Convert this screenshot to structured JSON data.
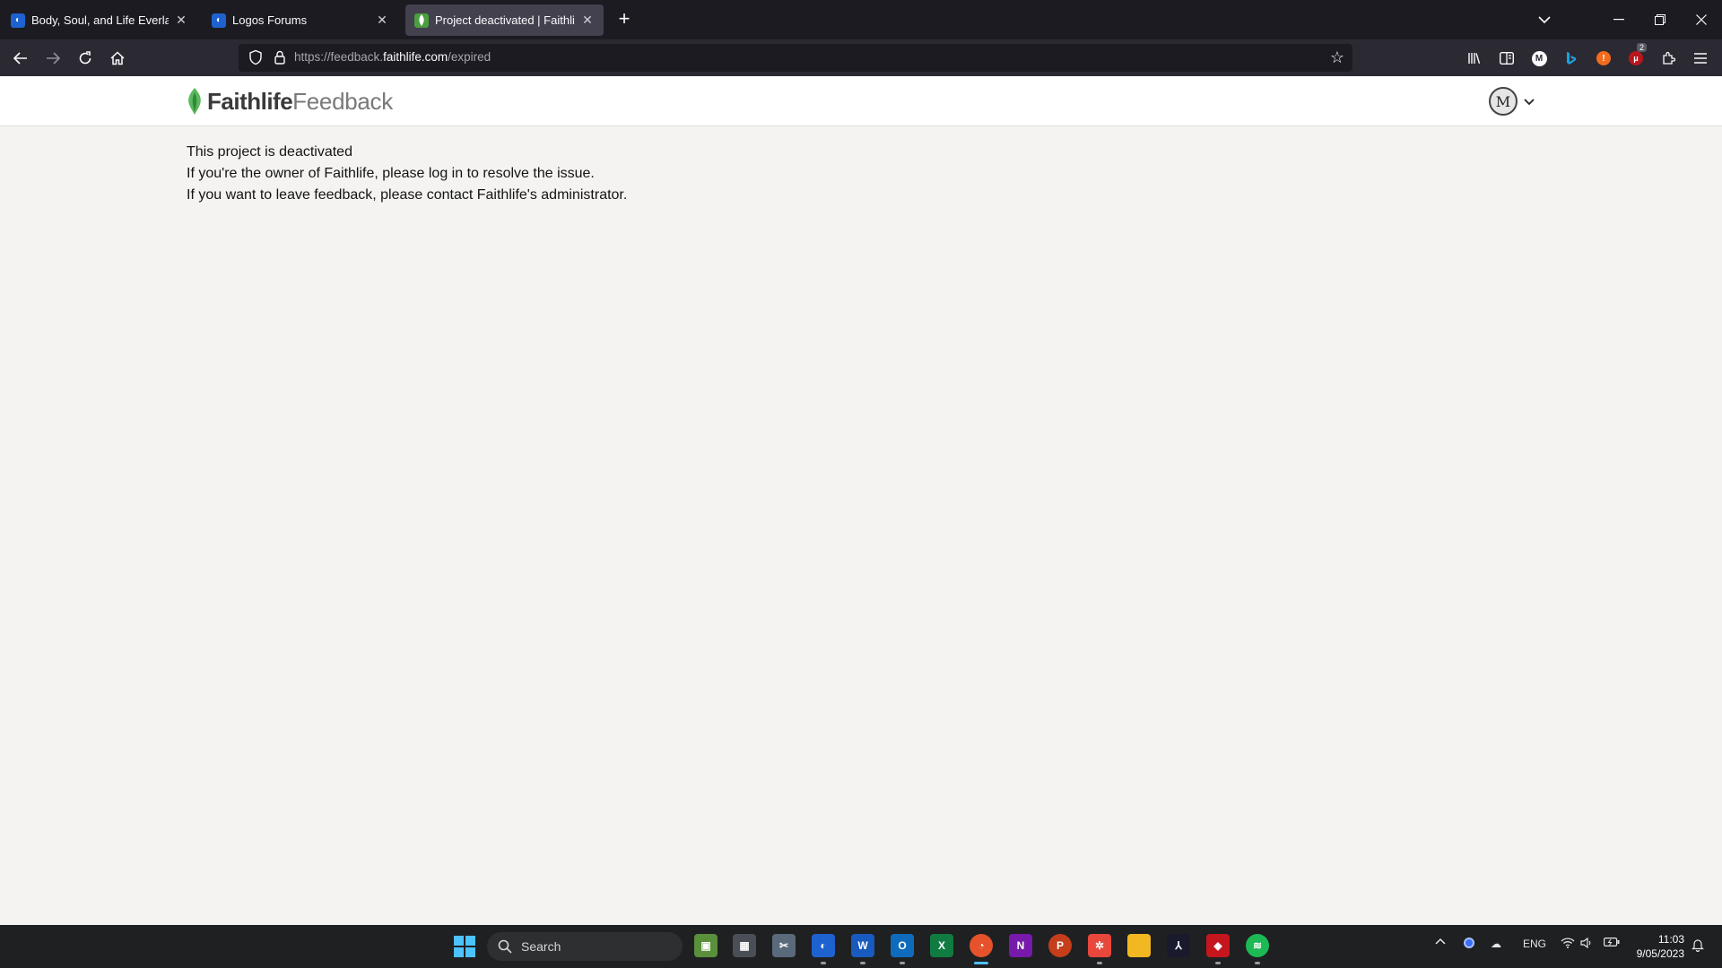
{
  "browser": {
    "tabs": [
      {
        "title": "Body, Soul, and Life Everlasting:",
        "favicon": "logos-icon",
        "active": false
      },
      {
        "title": "Logos Forums",
        "favicon": "logos-icon",
        "active": false
      },
      {
        "title": "Project deactivated | Faithlife",
        "favicon": "faithlife-icon",
        "active": true
      }
    ],
    "new_tab_label": "+",
    "url": {
      "prefix": "https://feedback.",
      "host": "faithlife.com",
      "path": "/expired"
    },
    "toolbar_icons": [
      "library-icon",
      "sidebar-icon",
      "m-extension-icon",
      "bing-icon",
      "brave-extension-icon",
      "ublock-icon",
      "extensions-icon",
      "menu-icon"
    ],
    "ublock_badge": "2"
  },
  "header": {
    "brand": "Faithlife",
    "product": "Feedback",
    "avatar_initials": "M"
  },
  "content": {
    "line1": "This project is deactivated",
    "line2": "If you're the owner of Faithlife, please log in to resolve the issue.",
    "line3": "If you want to leave feedback, please contact Faithlife's administrator."
  },
  "taskbar": {
    "search_label": "Search",
    "apps": [
      "greenshot-icon",
      "calculator-icon",
      "snipping-icon",
      "logos-icon",
      "word-icon",
      "outlook-icon",
      "excel-icon",
      "firefox-icon",
      "onenote-icon",
      "powerpoint-icon",
      "xmind-icon",
      "file-explorer-icon",
      "acrobat-icon",
      "pdf-editor-icon",
      "spotify-icon"
    ],
    "language": "ENG",
    "time": "11:03",
    "date": "9/05/2023"
  },
  "colors": {
    "brand_green": "#5cb85c",
    "page_bg": "#f4f3f1",
    "tab_strip": "#1c1b22",
    "nav_bar": "#2b2a33"
  }
}
